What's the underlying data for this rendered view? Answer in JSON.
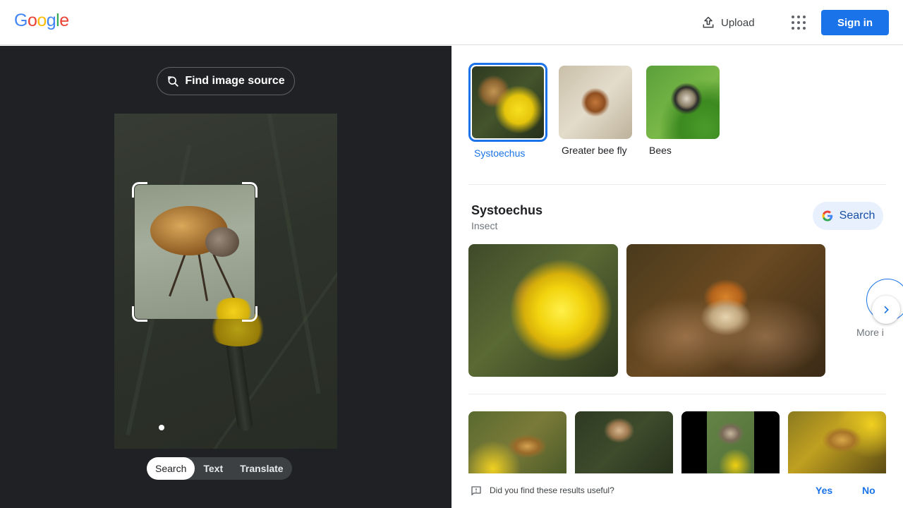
{
  "header": {
    "logo_letters": [
      {
        "ch": "G",
        "color": "#4285f4"
      },
      {
        "ch": "o",
        "color": "#ea4335"
      },
      {
        "ch": "o",
        "color": "#fbbc05"
      },
      {
        "ch": "g",
        "color": "#4285f4"
      },
      {
        "ch": "l",
        "color": "#34a853"
      },
      {
        "ch": "e",
        "color": "#ea4335"
      }
    ],
    "upload_label": "Upload",
    "signin_label": "Sign in",
    "accent": "#1a73e8"
  },
  "left": {
    "find_source_label": "Find image source",
    "modes": [
      "Search",
      "Text",
      "Translate"
    ],
    "active_mode": "Search"
  },
  "right": {
    "chips": [
      {
        "label": "Systoechus",
        "selected": true
      },
      {
        "label": "Greater bee fly",
        "selected": false
      },
      {
        "label": "Bees",
        "selected": false
      }
    ],
    "knowledge": {
      "title": "Systoechus",
      "subtitle": "Insect",
      "search_label": "Search",
      "more_label": "More i"
    }
  },
  "feedback": {
    "question": "Did you find these results useful?",
    "yes": "Yes",
    "no": "No"
  }
}
